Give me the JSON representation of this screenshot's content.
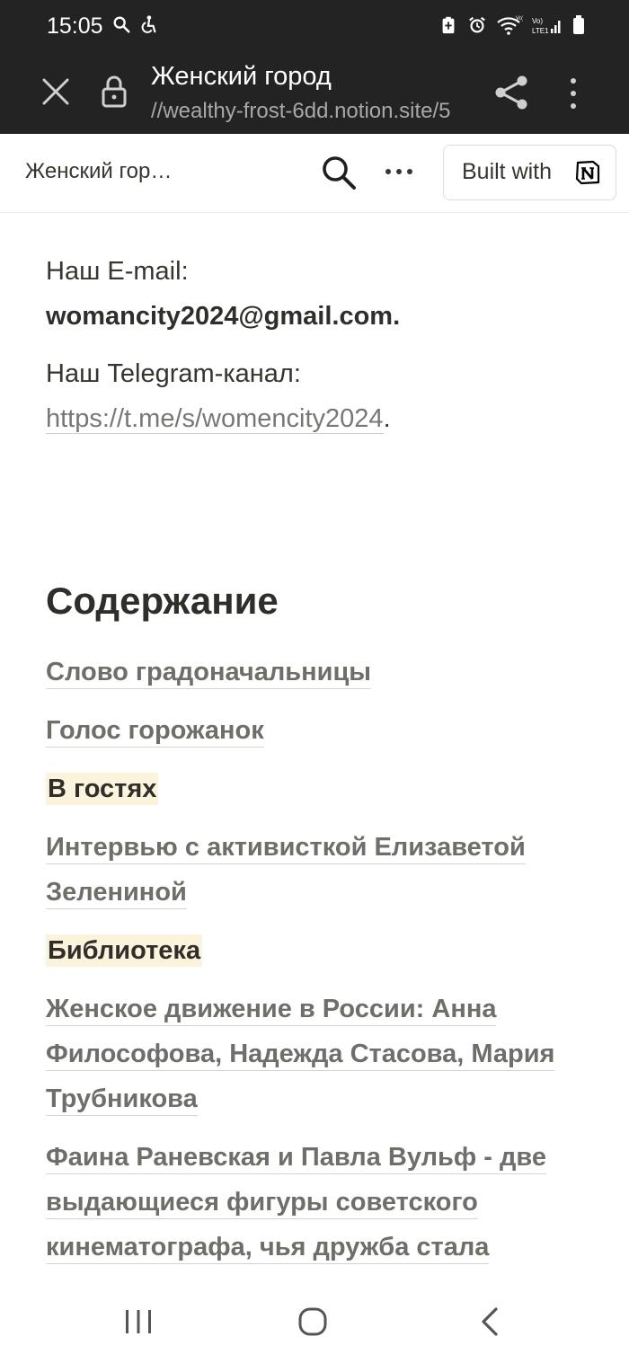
{
  "status_bar": {
    "time": "15:05"
  },
  "browser": {
    "title": "Женский город",
    "url": "//wealthy-frost-6dd.notion.site/5"
  },
  "notion_bar": {
    "title": "Женский гор…",
    "built_with_label": "Built with"
  },
  "content": {
    "email_label": "Наш E-mail:",
    "email_value": "womancity2024@gmail.com.",
    "telegram_label": "Наш Telegram-канал:",
    "telegram_link": "https://t.me/s/womencity2024",
    "telegram_trailing": ".",
    "toc_heading": "Содержание",
    "toc_items": [
      {
        "label": "Слово градоначальницы",
        "type": "link"
      },
      {
        "label": "Голос горожанок",
        "type": "link"
      },
      {
        "label": "В гостях",
        "type": "highlight"
      },
      {
        "label": "Интервью с активисткой Елизаветой Зелениной",
        "type": "link"
      },
      {
        "label": "Библиотека",
        "type": "highlight"
      },
      {
        "label": "Женское движение в России: Анна Философова, Надежда Стасова, Мария Трубникова",
        "type": "link"
      },
      {
        "label": "Фаина Раневская и Павла Вульф - две выдающиеся фигуры советского кинематографа, чья дружба стала",
        "type": "link"
      }
    ]
  },
  "colors": {
    "chrome_bg": "#232323",
    "text": "#37352f",
    "link": "#787774",
    "highlight_bg": "#fbf3db"
  }
}
